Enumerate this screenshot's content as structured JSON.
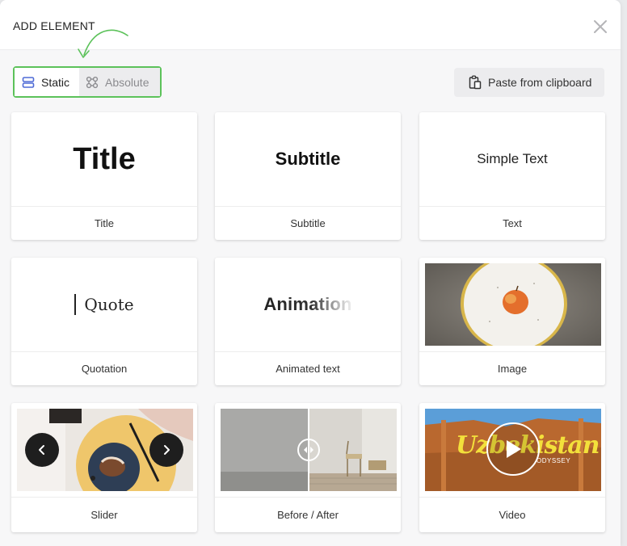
{
  "dialog": {
    "title": "ADD ELEMENT"
  },
  "mode_toggle": {
    "static_label": "Static",
    "absolute_label": "Absolute",
    "selected": "Static",
    "highlight_color": "#5cc25a"
  },
  "paste_button": {
    "label": "Paste from clipboard"
  },
  "elements": [
    {
      "label": "Title",
      "preview_text": "Title"
    },
    {
      "label": "Subtitle",
      "preview_text": "Subtitle"
    },
    {
      "label": "Text",
      "preview_text": "Simple Text"
    },
    {
      "label": "Quotation",
      "preview_text": "Quote"
    },
    {
      "label": "Animated text",
      "preview_text": "Animation"
    },
    {
      "label": "Image"
    },
    {
      "label": "Slider"
    },
    {
      "label": "Before / After"
    },
    {
      "label": "Video",
      "preview_text": "Uzbekistan",
      "preview_subtext": "ODYSSEY"
    }
  ],
  "icons": {
    "close": "close-icon",
    "static": "stack-rows-icon",
    "absolute": "nodes-icon",
    "paste": "clipboard-icon",
    "slider_prev": "chevron-left-icon",
    "slider_next": "chevron-right-icon",
    "compare_handle": "drag-handle-icon",
    "video_play": "play-icon"
  }
}
